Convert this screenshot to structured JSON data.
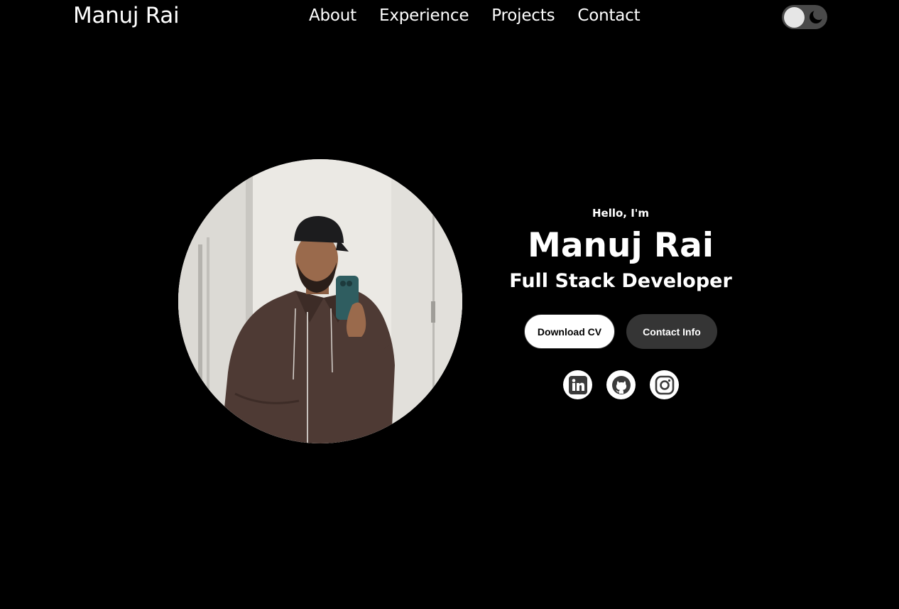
{
  "nav": {
    "logo": "Manuj Rai",
    "links": [
      {
        "label": "About"
      },
      {
        "label": "Experience"
      },
      {
        "label": "Projects"
      },
      {
        "label": "Contact"
      }
    ],
    "theme_toggle": {
      "state": "dark",
      "icon": "moon-icon"
    }
  },
  "hero": {
    "greeting": "Hello, I'm",
    "name": "Manuj Rai",
    "role": "Full Stack Developer",
    "buttons": {
      "download_cv": "Download CV",
      "contact_info": "Contact Info"
    },
    "socials": [
      {
        "icon": "linkedin-icon"
      },
      {
        "icon": "github-icon"
      },
      {
        "icon": "instagram-icon"
      }
    ]
  },
  "colors": {
    "background": "#000000",
    "text": "#ffffff",
    "button_dark": "#353535",
    "toggle_track": "#4a4a4a"
  }
}
